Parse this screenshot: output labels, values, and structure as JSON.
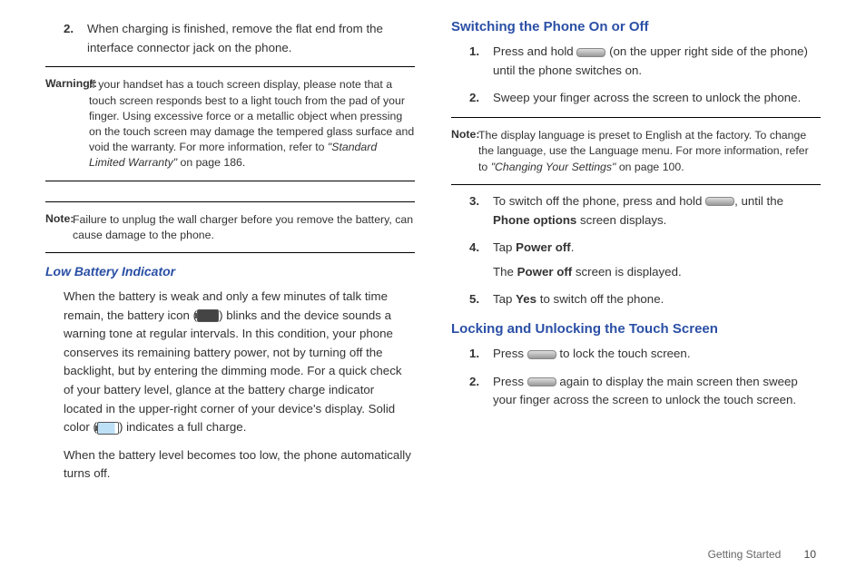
{
  "left": {
    "step2": "When charging is finished, remove the flat end from the interface connector jack on the phone.",
    "warning_label": "Warning!:",
    "warning_text_a": "If your handset has a touch screen display, please note that a touch screen responds best to a light touch from the pad of your finger. Using excessive force or a metallic object when pressing on the touch screen may damage the tempered glass surface and void the warranty. For more information, refer to ",
    "warning_ref": "\"Standard Limited Warranty\"",
    "warning_text_b": " on page 186.",
    "note_label": "Note:",
    "note_text": "Failure to unplug the wall charger before you remove the battery, can cause damage to the phone.",
    "low_batt_head": "Low Battery Indicator",
    "low_para1a": "When the battery is weak and only a few minutes of talk time remain, the battery icon (",
    "low_para1b": ") blinks and the device sounds a warning tone at regular intervals. In this condition, your phone conserves its remaining battery power, not by turning off the backlight, but by entering the dimming mode. For a quick check of your battery level, glance at the battery charge indicator located in the upper-right corner of your device's display. Solid color (",
    "low_para1c": ") indicates a full charge.",
    "low_para2": "When the battery level becomes too low, the phone automatically turns off."
  },
  "right": {
    "switch_head": "Switching the Phone On or Off",
    "s1a": "Press and hold ",
    "s1b": " (on the upper right side of the phone) until the phone switches on.",
    "s2": "Sweep your finger across the screen to unlock the phone.",
    "note_label": "Note:",
    "note_a": "The display language is preset to English at the factory. To change the language, use the Language menu. For more information, refer to ",
    "note_ref": "\"Changing Your Settings\"",
    "note_b": " on page 100.",
    "s3a": "To switch off the phone, press and hold ",
    "s3b": ", until the ",
    "s3_bold1": "Phone options",
    "s3c": " screen displays.",
    "s4a": "Tap ",
    "s4_bold": "Power off",
    "s4b": ".",
    "s4_line2a": "The ",
    "s4_line2_bold": "Power off",
    "s4_line2b": " screen is displayed.",
    "s5a": "Tap ",
    "s5_bold": "Yes",
    "s5b": " to switch off the phone.",
    "lock_head": "Locking and Unlocking the Touch Screen",
    "l1a": "Press ",
    "l1b": " to lock the touch screen.",
    "l2a": "Press ",
    "l2b": " again to display the main screen then sweep your finger across the screen to unlock the touch screen."
  },
  "footer": {
    "section": "Getting Started",
    "page": "10"
  }
}
